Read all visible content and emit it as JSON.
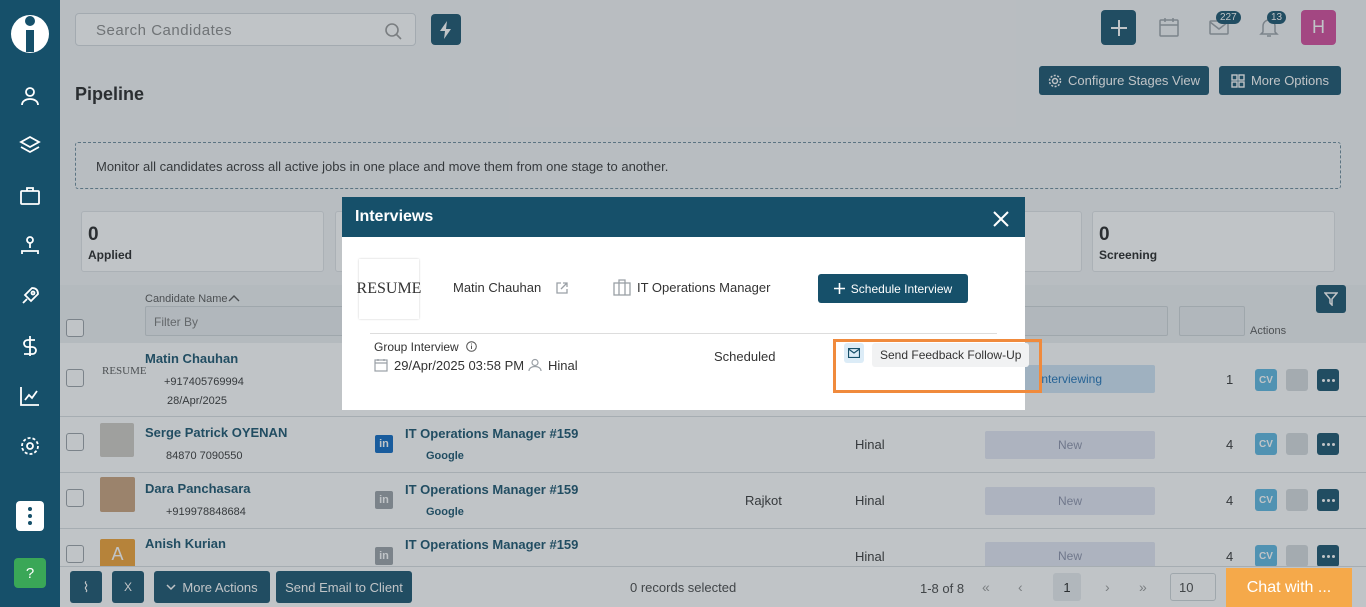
{
  "topbar": {
    "search_placeholder": "Search Candidates",
    "mail_badge": "227",
    "notif_badge": "13",
    "avatar_letter": "H"
  },
  "page": {
    "title": "Pipeline",
    "configure_btn": "Configure Stages View",
    "more_options_btn": "More Options",
    "info_text": "Monitor all candidates across all active jobs in one place and move them from one stage to another."
  },
  "stats": [
    {
      "count": "0",
      "label": "Applied"
    },
    {
      "count": "0",
      "label": "Screening"
    }
  ],
  "table": {
    "col_candidate": "Candidate Name",
    "filter_placeholder": "Filter By",
    "col_actions": "Actions",
    "rows": [
      {
        "name": "Matin Chauhan",
        "phone": "+917405769994",
        "date": "28/Apr/2025",
        "stage": "Interviewing",
        "count": "1"
      },
      {
        "name": "Serge Patrick OYENAN",
        "phone": "84870 7090550",
        "job": "IT Operations Manager #159",
        "company": "Google",
        "owner": "Hinal",
        "stage": "New",
        "count": "4"
      },
      {
        "name": "Dara Panchasara",
        "phone": "+919978848684",
        "job": "IT Operations Manager #159",
        "company": "Google",
        "location": "Rajkot",
        "owner": "Hinal",
        "stage": "New",
        "count": "4"
      },
      {
        "name": "Anish Kurian",
        "job": "IT Operations Manager #159",
        "owner": "Hinal",
        "stage": "New",
        "count": "4"
      }
    ],
    "cv_label": "CV"
  },
  "bottom": {
    "more_actions": "More Actions",
    "send_email": "Send Email to Client",
    "records_selected": "0 records selected",
    "range": "1-8 of 8",
    "page": "1",
    "per_page": "10"
  },
  "chat": {
    "label": "Chat with ..."
  },
  "modal": {
    "title": "Interviews",
    "resume_text": "RESUME",
    "candidate": "Matin Chauhan",
    "job": "IT Operations Manager",
    "schedule_btn": "Schedule Interview",
    "interview_type": "Group Interview",
    "datetime": "29/Apr/2025 03:58 PM",
    "interviewer": "Hinal",
    "status": "Scheduled",
    "tooltip": "Send Feedback Follow-Up"
  },
  "colors": {
    "primary": "#16506a",
    "highlight": "#f08a3c",
    "chat": "#f5a94a"
  }
}
